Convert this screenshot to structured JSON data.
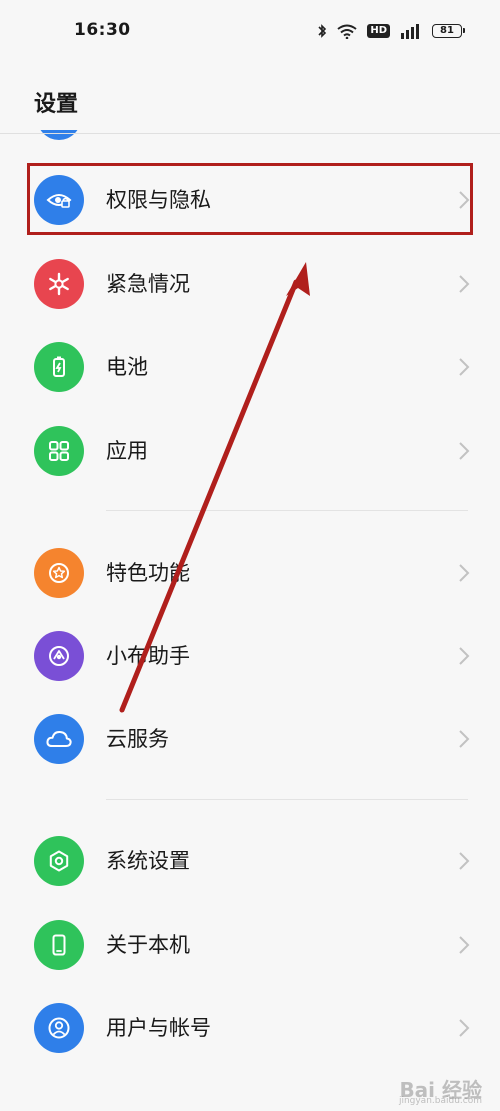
{
  "status_bar": {
    "time": "16:30",
    "battery": "81",
    "hd": "HD",
    "icons": [
      "bluetooth-icon",
      "wifi-icon",
      "hd-icon",
      "signal-icon",
      "battery-icon"
    ]
  },
  "header": {
    "title": "设置"
  },
  "menu": [
    {
      "label": "权限与隐私",
      "icon": "eye-lock-icon",
      "color": "#2f7fe9"
    },
    {
      "label": "紧急情况",
      "icon": "asterisk-icon",
      "color": "#e8454f"
    },
    {
      "label": "电池",
      "icon": "battery-charge-icon",
      "color": "#2fc35b"
    },
    {
      "label": "应用",
      "icon": "apps-grid-icon",
      "color": "#2fc35b"
    },
    {
      "label": "特色功能",
      "icon": "star-badge-icon",
      "color": "#f5842e"
    },
    {
      "label": "小布助手",
      "icon": "assistant-icon",
      "color": "#7a4fd6"
    },
    {
      "label": "云服务",
      "icon": "cloud-icon",
      "color": "#2f7fe9"
    },
    {
      "label": "系统设置",
      "icon": "hex-gear-icon",
      "color": "#2fc35b"
    },
    {
      "label": "关于本机",
      "icon": "phone-icon",
      "color": "#2fc35b"
    },
    {
      "label": "用户与帐号",
      "icon": "user-icon",
      "color": "#2f7fe9"
    }
  ],
  "annotation": {
    "color": "#b01f1c"
  },
  "watermark": {
    "text": "Bai 经验",
    "url": "jingyan.baidu.com"
  }
}
